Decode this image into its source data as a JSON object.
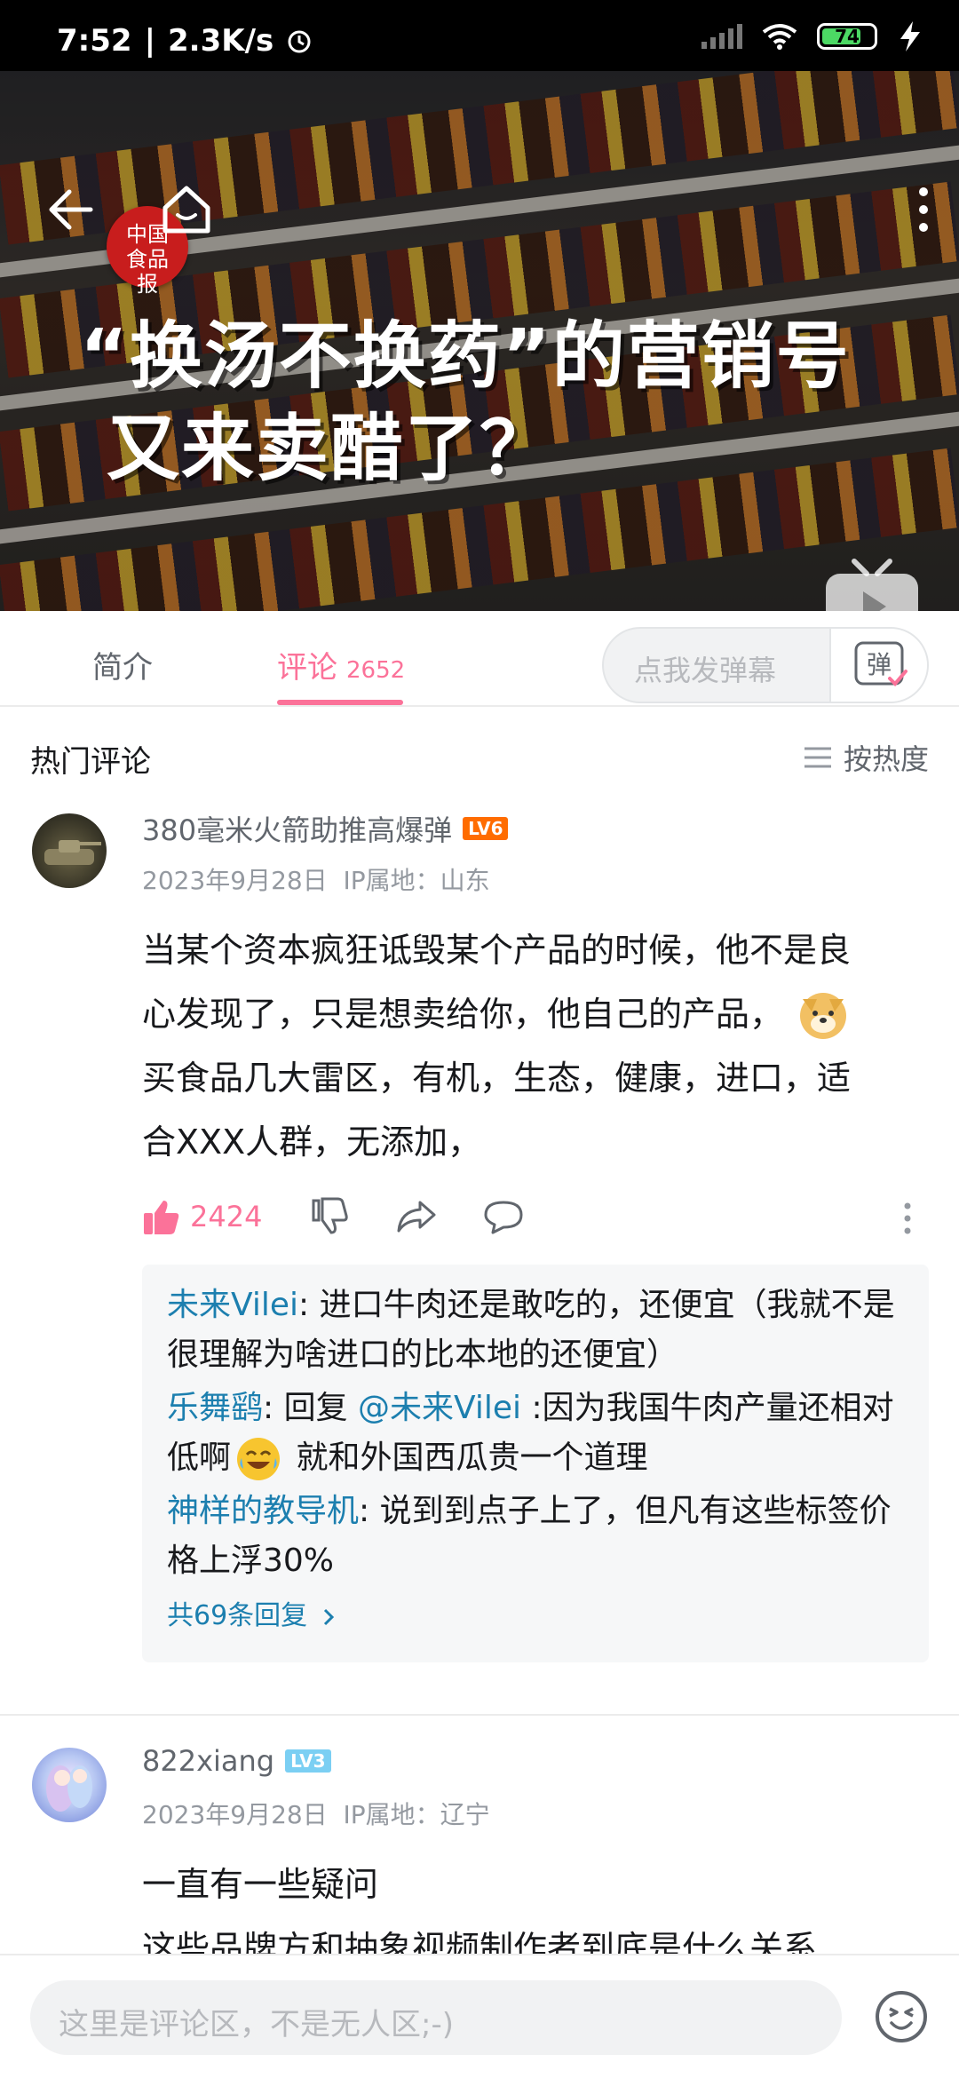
{
  "status_bar": {
    "time": "7:52",
    "speed": "2.3K/s",
    "battery": "74"
  },
  "video": {
    "title_line1": "“换汤不换药”的营销号",
    "title_line2": "又来卖醋了？",
    "logo_text": "中国食品报"
  },
  "tabs": {
    "intro": "简介",
    "comments": "评论",
    "comments_count": "2652",
    "danmu_placeholder": "点我发弹幕",
    "danmu_button": "弹"
  },
  "hot": {
    "title": "热门评论",
    "sort": "按热度"
  },
  "comments": [
    {
      "username": "380毫米火箭助推高爆弹",
      "level": "LV6",
      "date": "2023年9月28日",
      "ip": "IP属地：山东",
      "text_line1": "当某个资本疯狂诋毁某个产品的时候，他不是良",
      "text_line2": "心发现了，只是想卖给你，他自己的产品，",
      "text_line3": "买食品几大雷区，有机，生态，健康，进口，适",
      "text_line4": "合XXX人群，无添加，",
      "likes": "2424",
      "replies": [
        {
          "user": "未来Vilei",
          "text": ": 进口牛肉还是敢吃的，还便宜（我就不是很理解为啥进口的比本地的还便宜）"
        },
        {
          "user": "乐舞鹞",
          "text_pre": ": 回复 ",
          "at": "@未来Vilei",
          "text": " :因为我国牛肉产量还相对低啊",
          "text_post": " 就和外国西瓜贵一个道理"
        },
        {
          "user": "神样的教导机",
          "text": ": 说到到点子上了，但凡有这些标签价格上浮30%"
        }
      ],
      "more_replies": "共69条回复"
    },
    {
      "username": "822xiang",
      "level": "LV3",
      "date": "2023年9月28日",
      "ip": "IP属地：辽宁",
      "text_line1": "一直有一些疑问",
      "text_line2": "这些品牌方和抽象视频制作者到底是什么关系"
    }
  ],
  "bottom": {
    "placeholder": "这里是评论区，不是无人区;-)"
  }
}
